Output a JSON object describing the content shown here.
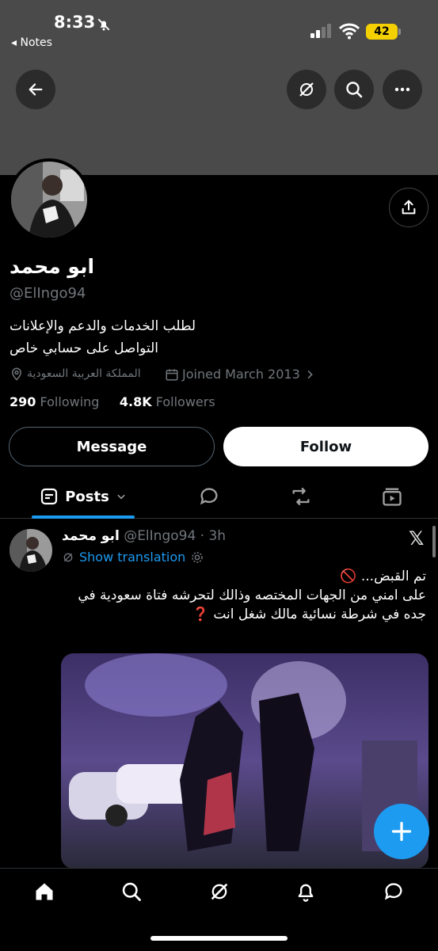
{
  "status_bar": {
    "time": "8:33",
    "back_app": "◂ Notes",
    "battery": "42"
  },
  "profile": {
    "name": "ابو محمد",
    "handle": "@ElIngo94",
    "bio_line1": "لطلب الخدمات والدعم والإعلانات",
    "bio_line2": "التواصل على حسابي خاص",
    "location": "المملكة العربية السعودية",
    "joined": "Joined March 2013",
    "following_count": "290",
    "following_label": "Following",
    "followers_count": "4.8K",
    "followers_label": "Followers"
  },
  "buttons": {
    "message": "Message",
    "follow": "Follow"
  },
  "tabs": {
    "posts": "Posts"
  },
  "post": {
    "author": "ابو محمد",
    "handle_time": "@ElIngo94 · 3h",
    "show_translation": "Show translation",
    "line1": "تم القبض... 🚫",
    "line2": "على امني من الجهات المختصه وذالك لتحرشه فتاة سعودية في",
    "line3": "جده في شرطة نسائية مالك شغل انت ❓"
  },
  "colors": {
    "accent": "#1d9bf0",
    "banner": "#4a4a4a",
    "muted": "#71767b"
  },
  "icons": [
    "back-arrow-icon",
    "grok-icon",
    "search-icon",
    "more-icon",
    "share-icon",
    "location-icon",
    "calendar-icon",
    "chevron-right-icon",
    "posts-icon",
    "chevron-down-icon",
    "reply-icon",
    "repost-icon",
    "media-icon",
    "x-logo-icon",
    "translate-icon",
    "settings-icon",
    "plus-icon",
    "home-icon",
    "notifications-icon",
    "messages-icon"
  ]
}
